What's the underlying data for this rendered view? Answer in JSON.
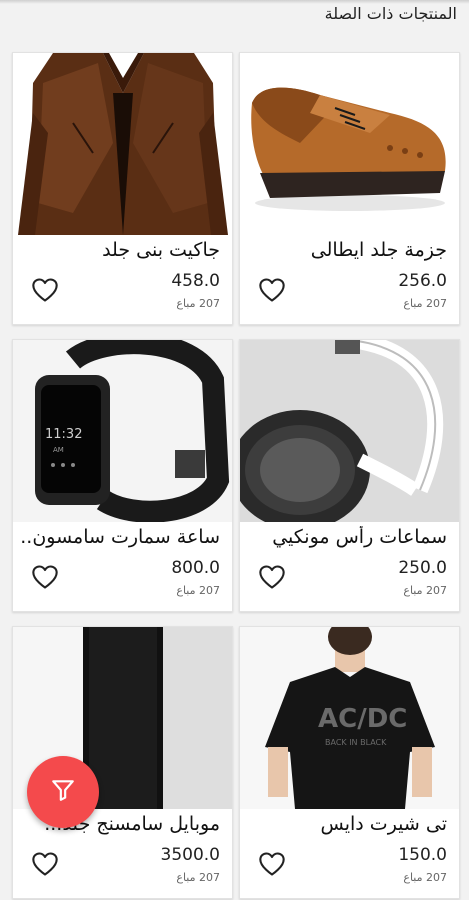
{
  "section_title": "المنتجات ذات الصلة",
  "products": [
    {
      "name": "جاكيت بنى جلد",
      "price": "458.0",
      "sold": "207 مباع",
      "image": "brown-leather-jacket"
    },
    {
      "name": "جزمة جلد ايطالى",
      "price": "256.0",
      "sold": "207 مباع",
      "image": "brown-leather-brogue-shoe"
    },
    {
      "name": "ساعة سمارت سامسون..",
      "price": "800.0",
      "sold": "207 مباع",
      "image": "black-smartwatch"
    },
    {
      "name": "سماعات رأس مونكيي",
      "price": "250.0",
      "sold": "207 مباع",
      "image": "white-headphones"
    },
    {
      "name": "موبايل سامسنج جلد...",
      "price": "3500.0",
      "sold": "207 مباع",
      "image": "black-samsung-phone"
    },
    {
      "name": "تى شيرت دايس",
      "price": "150.0",
      "sold": "207 مباع",
      "image": "black-acdc-tshirt"
    }
  ],
  "icons": {
    "favorite": "heart-outline-icon",
    "filter": "filter-icon"
  },
  "colors": {
    "fab": "#f44a4c",
    "card_bg": "#ffffff",
    "page_bg": "#f2f2f2"
  }
}
